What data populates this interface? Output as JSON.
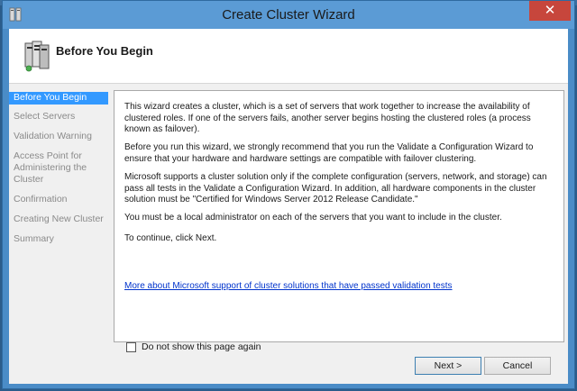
{
  "window": {
    "title": "Create Cluster Wizard",
    "close_glyph": "✕",
    "background_text": "Create Cluster Wizard"
  },
  "header": {
    "title": "Before You Begin",
    "icon": "server-cluster-icon"
  },
  "nav": {
    "items": [
      {
        "label": "Before You Begin",
        "active": true
      },
      {
        "label": "Select Servers",
        "active": false
      },
      {
        "label": "Validation Warning",
        "active": false
      },
      {
        "label": "Access Point for Administering the Cluster",
        "active": false
      },
      {
        "label": "Confirmation",
        "active": false
      },
      {
        "label": "Creating New Cluster",
        "active": false
      },
      {
        "label": "Summary",
        "active": false
      }
    ]
  },
  "content": {
    "paragraphs": [
      "This wizard creates a cluster, which is a set of servers that work together to increase the availability of clustered roles. If one of the servers fails, another server begins hosting the clustered roles (a process known as failover).",
      "Before you run this wizard, we strongly recommend that you run the Validate a Configuration Wizard to ensure that your hardware and hardware settings are compatible with failover clustering.",
      "Microsoft supports a cluster solution only if the complete configuration (servers, network, and storage) can pass all tests in the Validate a Configuration Wizard. In addition, all hardware components in the cluster solution must be \"Certified for Windows Server 2012 Release Candidate.\"",
      "You must be a local administrator on each of the servers that you want to include in the cluster.",
      "To continue, click Next."
    ],
    "link": "More about Microsoft support of cluster solutions that have passed validation tests"
  },
  "footer": {
    "checkbox_label": "Do not show this page again",
    "checkbox_checked": false,
    "next_label": "Next >",
    "cancel_label": "Cancel"
  },
  "colors": {
    "title_bar": "#5b9bd5",
    "close_button": "#c7463c",
    "nav_active": "#3399ff",
    "link": "#0033cc"
  }
}
